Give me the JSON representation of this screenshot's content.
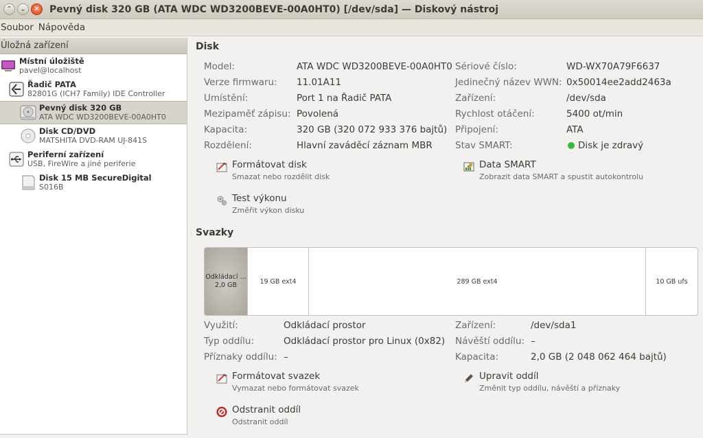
{
  "window": {
    "title": "Pevný disk 320 GB (ATA WDC WD3200BEVE-00A0HT0) [/dev/sda] — Diskový nástroj"
  },
  "menu": [
    "Soubor",
    "Nápověda"
  ],
  "sidebar": {
    "header": "Úložná zařízení",
    "items": [
      {
        "name": "Místní úložiště",
        "sub": "pavel@localhost",
        "icon": "computer-icon"
      },
      {
        "name": "Řadič PATA",
        "sub": "82801G (ICH7 Family) IDE Controller",
        "icon": "controller-icon"
      },
      {
        "name": "Pevný disk 320 GB",
        "sub": "ATA WDC WD3200BEVE-00A0HT0",
        "icon": "harddisk-icon",
        "selected": true
      },
      {
        "name": "Disk CD/DVD",
        "sub": "MATSHITA DVD-RAM UJ-841S",
        "icon": "optical-disc-icon"
      },
      {
        "name": "Periferní zařízení",
        "sub": "USB, FireWire a jiné periferie",
        "icon": "usb-icon"
      },
      {
        "name": "Disk 15 MB SecureDigital",
        "sub": "S016B",
        "icon": "sd-card-icon"
      }
    ]
  },
  "disk": {
    "title": "Disk",
    "left": [
      {
        "label": "Model:",
        "value": "ATA WDC WD3200BEVE-00A0HT0"
      },
      {
        "label": "Verze firmwaru:",
        "value": "11.01A11"
      },
      {
        "label": "Umístění:",
        "value": "Port 1 na Řadič PATA"
      },
      {
        "label": "Mezipaměť zápisu:",
        "value": "Povolená"
      },
      {
        "label": "Kapacita:",
        "value": "320 GB (320 072 933 376 bajtů)"
      },
      {
        "label": "Rozdělení:",
        "value": "Hlavní zaváděcí záznam MBR"
      }
    ],
    "right": [
      {
        "label": "Sériové číslo:",
        "value": "WD-WX70A79F6637"
      },
      {
        "label": "Jedinečný název WWN:",
        "value": "0x50014ee2add2463a"
      },
      {
        "label": "Zařízení:",
        "value": "/dev/sda"
      },
      {
        "label": "Rychlost otáčení:",
        "value": "5400 ot/min"
      },
      {
        "label": "Připojení:",
        "value": "ATA"
      },
      {
        "label": "Stav SMART:",
        "value": "Disk je zdravý",
        "status_color": "#2fbf3a"
      }
    ],
    "actions": {
      "format": {
        "label": "Formátovat disk",
        "desc": "Smazat nebo rozdělit disk"
      },
      "smart": {
        "label": "Data SMART",
        "desc": "Zobrazit data SMART a spustit autokontrolu"
      },
      "benchmark": {
        "label": "Test výkonu",
        "desc": "Změřit výkon disku"
      }
    }
  },
  "volumes": {
    "title": "Svazky",
    "segments": [
      {
        "line1": "Odkládací ...",
        "line2": "2,0 GB",
        "selected": true
      },
      {
        "line1": "19 GB ext4"
      },
      {
        "line1": "289 GB ext4"
      },
      {
        "line1": "10 GB ufs"
      }
    ],
    "left": [
      {
        "label": "Využití:",
        "value": "Odkládací prostor"
      },
      {
        "label": "Typ oddílu:",
        "value": "Odkládací prostor pro Linux (0x82)"
      },
      {
        "label": "Příznaky oddílu:",
        "value": "–"
      }
    ],
    "right": [
      {
        "label": "Zařízení:",
        "value": "/dev/sda1"
      },
      {
        "label": "Návěští oddílu:",
        "value": "–"
      },
      {
        "label": "Kapacita:",
        "value": "2,0 GB (2 048 062 464 bajtů)"
      }
    ],
    "actions": {
      "format": {
        "label": "Formátovat svazek",
        "desc": "Vymazat nebo formátovat svazek"
      },
      "edit": {
        "label": "Upravit oddíl",
        "desc": "Změnit typ oddílu, návěští a příznaky"
      },
      "delete": {
        "label": "Odstranit oddíl",
        "desc": "Odstranit oddíl"
      }
    }
  }
}
